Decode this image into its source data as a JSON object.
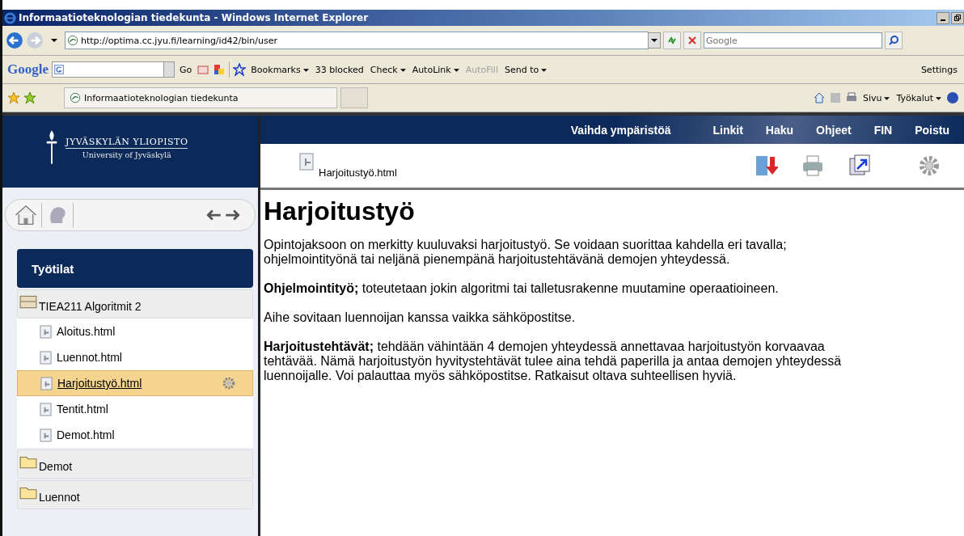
{
  "window": {
    "title": "Informaatioteknologian tiedekunta - Windows Internet Explorer"
  },
  "address_bar": {
    "url": "http://optima.cc.jyu.fi/learning/id42/bin/user",
    "search_placeholder": "Google"
  },
  "google_toolbar": {
    "brand": "Google",
    "go": "Go",
    "items": [
      {
        "label": "Bookmarks",
        "kind": "menu",
        "disabled": false
      },
      {
        "label": "33 blocked",
        "kind": "plain",
        "disabled": false
      },
      {
        "label": "Check",
        "kind": "menu",
        "disabled": false
      },
      {
        "label": "AutoLink",
        "kind": "menu",
        "disabled": false
      },
      {
        "label": "AutoFill",
        "kind": "plain",
        "disabled": true
      },
      {
        "label": "Send to",
        "kind": "menu",
        "disabled": false
      }
    ],
    "settings": "Settings"
  },
  "favorites_bar": {
    "tab_title": "Informaatioteknologian tiedekunta",
    "commands": [
      "Sivu",
      "Työkalut"
    ]
  },
  "site": {
    "logo_title": "JYVÄSKYLÄN YLIOPISTO",
    "logo_subtitle": "University of Jyväskylä",
    "nav_links": [
      "Vaihda ympäristöä",
      "Linkit",
      "Haku",
      "Ohjeet",
      "FIN",
      "Poistu"
    ],
    "current_file": "Harjoitustyö.html",
    "sidebar": {
      "heading": "Työtilat",
      "items": [
        {
          "label": "TIEA211 Algoritmit 2",
          "kind": "course",
          "children": [
            {
              "label": "Aloitus.html",
              "selected": false
            },
            {
              "label": "Luennot.html",
              "selected": false
            },
            {
              "label": "Harjoitustyö.html",
              "selected": true
            },
            {
              "label": "Tentit.html",
              "selected": false
            },
            {
              "label": "Demot.html",
              "selected": false
            }
          ]
        },
        {
          "label": "Demot",
          "kind": "folder"
        },
        {
          "label": "Luennot",
          "kind": "folder"
        }
      ]
    },
    "article": {
      "heading": "Harjoitustyö",
      "paragraphs": [
        "Opintojaksoon on merkitty kuuluvaksi harjoitustyö. Se voidaan suorittaa kahdella eri tavalla; ohjelmointityönä tai neljänä pienempänä harjoitustehtävänä demojen yhteydessä.",
        "**Ohjelmointityö;** toteutetaan jokin algoritmi tai talletusrakenne muutamine operaatioineen.",
        "Aihe sovitaan luennoijan kanssa vaikka sähköpostitse.",
        "**Harjoitustehtävät;** tehdään vähintään 4 demojen yhteydessä annettavaa harjoitustyön korvaavaa tehtävää. Nämä harjoitustyön hyvitystehtävät tulee aina tehdä paperilla ja antaa demojen yhteydessä luennoijalle. Voi palauttaa myös sähköpostitse. Ratkaisut oltava suhteellisen hyviä."
      ]
    }
  }
}
